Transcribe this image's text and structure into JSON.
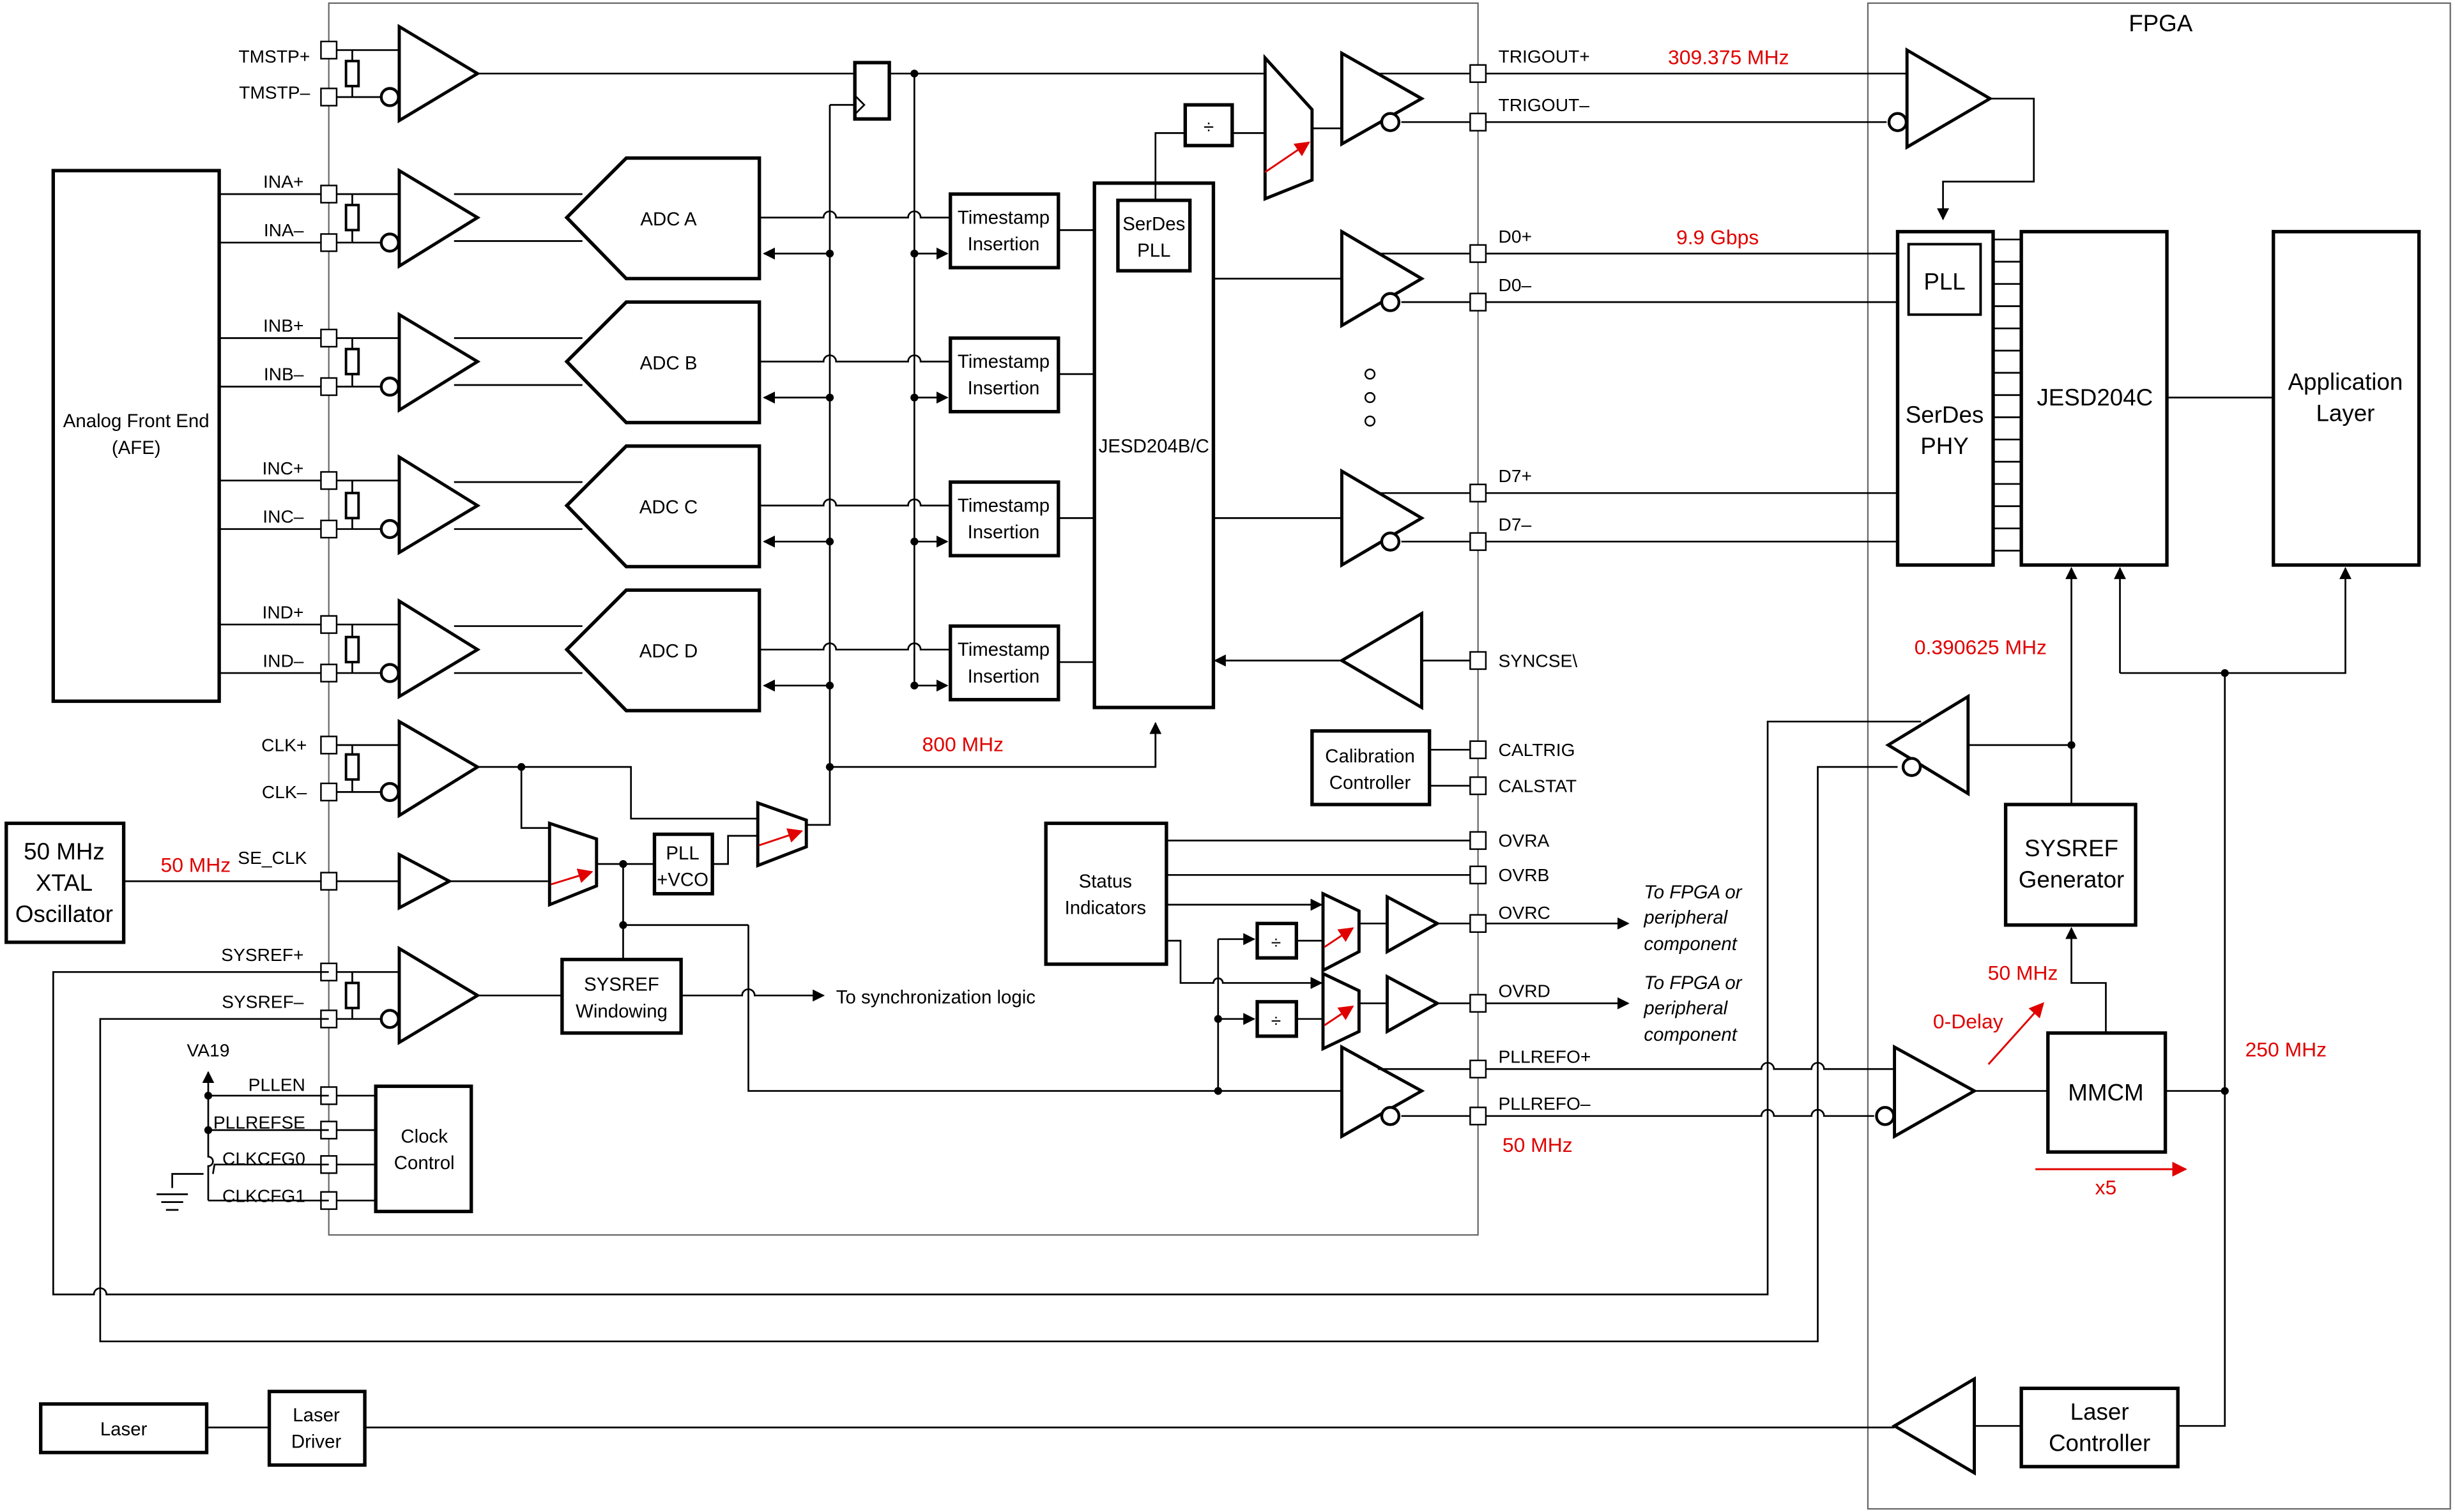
{
  "fpga_title": "FPGA",
  "left_blocks": {
    "afe": [
      "Analog Front End",
      "(AFE)"
    ],
    "xtal": [
      "50 MHz",
      "XTAL",
      "Oscillator"
    ],
    "laser": "Laser",
    "laser_driver": [
      "Laser",
      "Driver"
    ],
    "clock_control": [
      "Clock",
      "Control"
    ],
    "va19": "VA19"
  },
  "pins_left": {
    "tmstp_p": "TMSTP+",
    "tmstp_n": "TMSTP–",
    "ina_p": "INA+",
    "ina_n": "INA–",
    "inb_p": "INB+",
    "inb_n": "INB–",
    "inc_p": "INC+",
    "inc_n": "INC–",
    "ind_p": "IND+",
    "ind_n": "IND–",
    "clk_p": "CLK+",
    "clk_n": "CLK–",
    "se_clk": "SE_CLK",
    "sysref_p": "SYSREF+",
    "sysref_n": "SYSREF–",
    "pllen": "PLLEN",
    "pllrefse": "PLLREFSE",
    "clkcfg0": "CLKCFG0",
    "clkcfg1": "CLKCFG1"
  },
  "pins_right": {
    "trigout_p": "TRIGOUT+",
    "trigout_n": "TRIGOUT–",
    "d0_p": "D0+",
    "d0_n": "D0–",
    "d7_p": "D7+",
    "d7_n": "D7–",
    "syncse": "SYNCSE\\",
    "caltrig": "CALTRIG",
    "calstat": "CALSTAT",
    "ovra": "OVRA",
    "ovrb": "OVRB",
    "ovrc": "OVRC",
    "ovrd": "OVRD",
    "pllrefo_p": "PLLREFO+",
    "pllrefo_n": "PLLREFO–"
  },
  "adc_blocks": [
    "ADC A",
    "ADC B",
    "ADC C",
    "ADC D"
  ],
  "timestamp_insertion": [
    "Timestamp",
    "Insertion"
  ],
  "jesd_tx": "JESD204B/C",
  "serdes_pll": [
    "SerDes",
    "PLL"
  ],
  "pll_vco": [
    "PLL",
    "+VCO"
  ],
  "sysref_windowing": [
    "SYSREF",
    "Windowing"
  ],
  "sync_logic": "To synchronization logic",
  "calibration_controller": [
    "Calibration",
    "Controller"
  ],
  "status_indicators": [
    "Status",
    "Indicators"
  ],
  "peripheral_note": [
    "To FPGA or",
    "peripheral",
    "component"
  ],
  "divider_symbol": "÷",
  "fpga_blocks": {
    "pll": "PLL",
    "serdes_phy": [
      "SerDes",
      "PHY"
    ],
    "jesd_rx": "JESD204C",
    "application_layer": [
      "Application",
      "Layer"
    ],
    "sysref_generator": [
      "SYSREF",
      "Generator"
    ],
    "mmcm": "MMCM",
    "laser_controller": [
      "Laser",
      "Controller"
    ]
  },
  "annotations": {
    "trigout_freq": "309.375 MHz",
    "lane_rate": "9.9 Gbps",
    "sysref_freq": "0.390625 MHz",
    "clk_800": "800 MHz",
    "xtal_freq": "50 MHz",
    "pllrefo_freq": "50 MHz",
    "mmcm_in_freq": "50 MHz",
    "zero_delay": "0-Delay",
    "mmcm_out_freq": "250 MHz",
    "multiplier": "x5"
  },
  "colors": {
    "annotation": "#e00000",
    "line": "#000000"
  }
}
